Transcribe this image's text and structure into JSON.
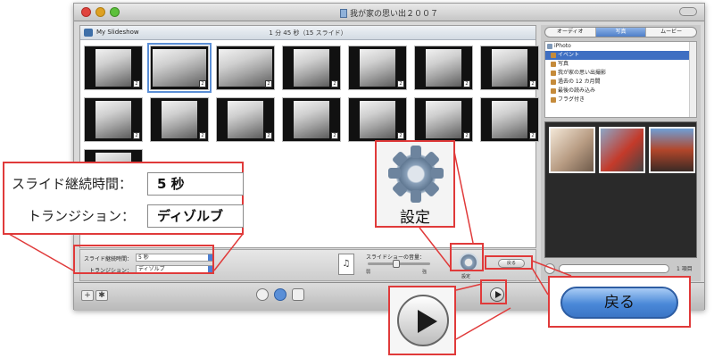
{
  "window": {
    "title": "我が家の思い出２００７"
  },
  "photo_area": {
    "project_name": "My Slideshow",
    "count_label": "1 分 45 秒（15 スライド）",
    "thumbnails": [
      {
        "badge": "2"
      },
      {
        "badge": "2"
      },
      {
        "badge": "2"
      },
      {
        "badge": "2"
      },
      {
        "badge": "2"
      },
      {
        "badge": "2"
      },
      {
        "badge": "2"
      },
      {
        "badge": "2"
      },
      {
        "badge": "2"
      },
      {
        "badge": "2"
      },
      {
        "badge": "2"
      },
      {
        "badge": "2"
      },
      {
        "badge": "2"
      },
      {
        "badge": "2"
      },
      {
        "badge": "2"
      }
    ]
  },
  "settings": {
    "duration_label": "スライド継続時間：",
    "duration_value": "5 秒",
    "transition_label": "トランジション：",
    "transition_value": "ディゾルブ",
    "small_duration_label": "スライド継続時間：",
    "small_duration_value": "5 秒",
    "small_transition_label": "トランジション：",
    "small_transition_value": "ディゾルブ",
    "volume_label": "スライドショーの音量：",
    "volume_min": "弱",
    "volume_max": "強",
    "volume_level_percent": 45,
    "settings_small_label": "設定",
    "back_small_label": "戻る"
  },
  "sidebar": {
    "tabs": [
      "オーディオ",
      "写真",
      "ムービー"
    ],
    "active_tab": 1,
    "source_items": [
      {
        "label": "iPhoto",
        "root": true
      },
      {
        "label": "イベント",
        "selected": true
      },
      {
        "label": "写真"
      },
      {
        "label": "我が家の思い出撮影"
      },
      {
        "label": "過去の 12 カ月間"
      },
      {
        "label": "最後の読み込み"
      },
      {
        "label": "フラグ付き"
      }
    ],
    "item_count": "1 項目"
  },
  "callouts": {
    "settings_big_label": "設定",
    "back_big_label": "戻る"
  },
  "colors": {
    "callout_border": "#e03a3a",
    "accent_blue": "#4e7fc8"
  }
}
